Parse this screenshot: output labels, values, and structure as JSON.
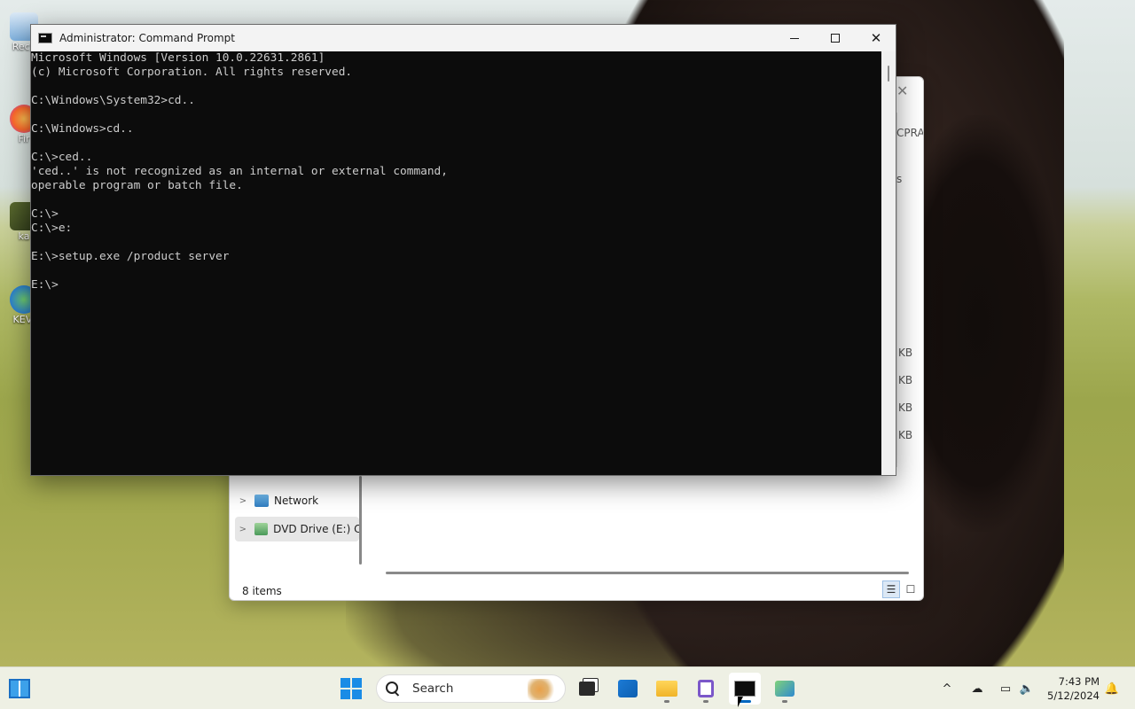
{
  "desktop": {
    "icons": [
      {
        "label": "Recy"
      },
      {
        "label": "Fir"
      },
      {
        "label": "ka"
      },
      {
        "label": "KEVI"
      }
    ]
  },
  "explorer": {
    "frag_cpra": "CPRA_",
    "frag_s": "s",
    "sizes": [
      "KB",
      "KB",
      "KB",
      "KB"
    ],
    "nav": [
      {
        "label": "Network"
      },
      {
        "label": "DVD Drive (E:) C"
      }
    ],
    "status": "8 items"
  },
  "cmd": {
    "title": "Administrator: Command Prompt",
    "lines": [
      "Microsoft Windows [Version 10.0.22631.2861]",
      "(c) Microsoft Corporation. All rights reserved.",
      "",
      "C:\\Windows\\System32>cd..",
      "",
      "C:\\Windows>cd..",
      "",
      "C:\\>ced..",
      "'ced..' is not recognized as an internal or external command,",
      "operable program or batch file.",
      "",
      "C:\\>",
      "C:\\>e:",
      "",
      "E:\\>setup.exe /product server",
      "",
      "E:\\>"
    ]
  },
  "taskbar": {
    "search_placeholder": "Search",
    "time": "7:43 PM",
    "date": "5/12/2024",
    "accent": "#0067c0"
  }
}
